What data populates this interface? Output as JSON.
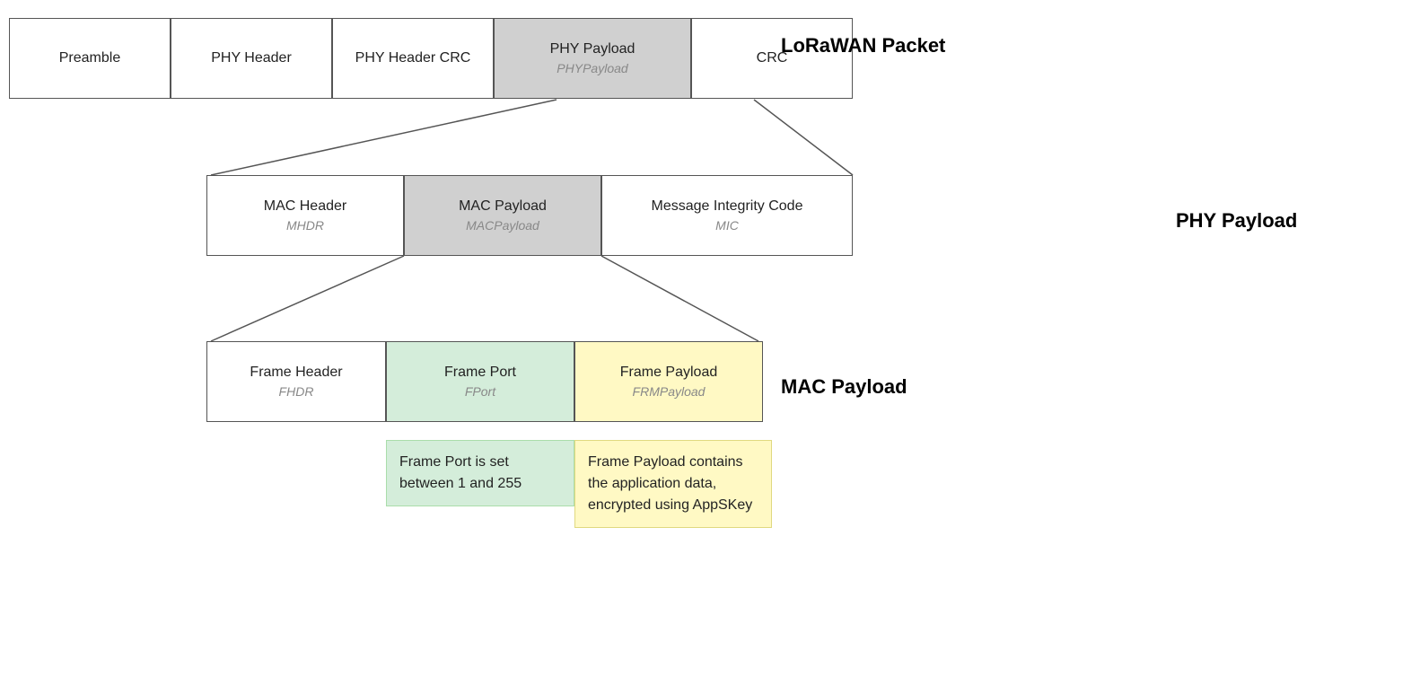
{
  "row1": {
    "label": "LoRaWAN Packet",
    "cells": [
      {
        "id": "preamble",
        "title": "Preamble",
        "subtitle": "",
        "style": ""
      },
      {
        "id": "phy-header",
        "title": "PHY Header",
        "subtitle": "",
        "style": ""
      },
      {
        "id": "phy-hdr-crc",
        "title": "PHY Header CRC",
        "subtitle": "",
        "style": ""
      },
      {
        "id": "phy-payload",
        "title": "PHY Payload",
        "subtitle": "PHYPayload",
        "style": "gray"
      },
      {
        "id": "crc",
        "title": "CRC",
        "subtitle": "",
        "style": ""
      }
    ]
  },
  "row2": {
    "label": "PHY Payload",
    "cells": [
      {
        "id": "mac-header",
        "title": "MAC Header",
        "subtitle": "MHDR",
        "style": ""
      },
      {
        "id": "mac-payload",
        "title": "MAC Payload",
        "subtitle": "MACPayload",
        "style": "gray"
      },
      {
        "id": "mic",
        "title": "Message Integrity Code",
        "subtitle": "MIC",
        "style": ""
      }
    ]
  },
  "row3": {
    "label": "MAC Payload",
    "cells": [
      {
        "id": "frame-header",
        "title": "Frame Header",
        "subtitle": "FHDR",
        "style": ""
      },
      {
        "id": "frame-port",
        "title": "Frame Port",
        "subtitle": "FPort",
        "style": "green"
      },
      {
        "id": "frame-payload",
        "title": "Frame Payload",
        "subtitle": "FRMPayload",
        "style": "yellow"
      }
    ]
  },
  "annotations": {
    "frame-port": "Frame Port is set between 1 and 255",
    "frame-payload": "Frame Payload contains the application data, encrypted using AppSKey"
  }
}
